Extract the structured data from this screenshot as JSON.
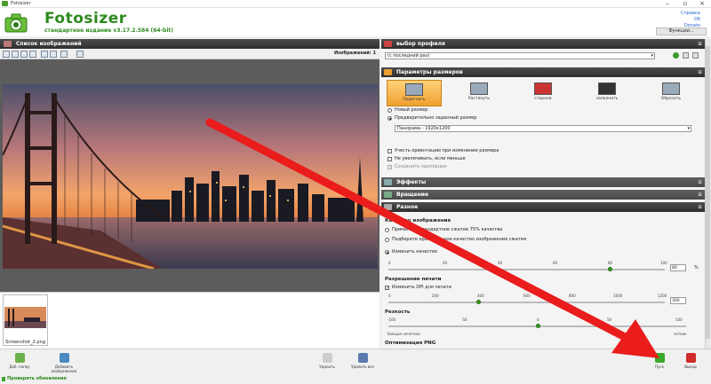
{
  "window": {
    "title": "Fotosizer"
  },
  "header": {
    "brand": "Fotosizer",
    "edition": "стандартное издание   v3.17.2.584   (64-bit)",
    "links": [
      "Справка",
      "Об",
      "Donate"
    ],
    "functions_button": "Функции..."
  },
  "left_panel": {
    "title": "Список изображений",
    "image_count": "Изображений: 1",
    "thumbnail_label": "Screenshot_2.png"
  },
  "profile": {
    "title": "выбор профиля",
    "selected": "(с последний раз)"
  },
  "size_params": {
    "title": "Параметры размеров",
    "modes": [
      "Подогнать",
      "Растянуть",
      "сторона",
      "заполнить",
      "Обрезать"
    ],
    "radio_new_size": "Новый размер",
    "radio_preset": "Предварительно заданный размер",
    "preset_value": "Панорама - 1920x1200",
    "opt_orientation": "Учесть ориентацию при изменении размера",
    "opt_no_upscale": "Не увеличивать, если меньше",
    "opt_keep_aspect": "Сохранить пропорции"
  },
  "sections": {
    "effects": "Эффекты",
    "rotation": "Вращение",
    "misc": "Разное"
  },
  "misc": {
    "quality_label": "Качество изображения",
    "quality_opt1": "Применить стандартное сжатие 75% качества",
    "quality_opt2": "Подберите оригинальное качество изображения сжатия",
    "quality_opt3": "Изменить качество",
    "quality_ticks": [
      "0",
      "20",
      "40",
      "60",
      "80",
      "100"
    ],
    "quality_value": "80",
    "quality_unit": "%",
    "print_res_label": "Разрешение печати",
    "dpi_label": "Изменить DPI для печати",
    "dpi_ticks": [
      "0",
      "200",
      "400",
      "600",
      "800",
      "1000",
      "1200"
    ],
    "dpi_value": "300",
    "sharpness_label": "Резкость",
    "sharp_ticks": [
      "-100",
      "-50",
      "0",
      "50",
      "100"
    ],
    "sharp_left": "больше нечеткое",
    "sharp_right": "четкие",
    "png_label": "Оптимизация PNG"
  },
  "bottom": {
    "add_files": "Доб. папку",
    "add_images": "Добавить изображения",
    "remove": "Удалить",
    "remove_all": "Удалить все",
    "start": "Пуск",
    "exit": "Выход",
    "check_updates": "Проверить обновления"
  }
}
